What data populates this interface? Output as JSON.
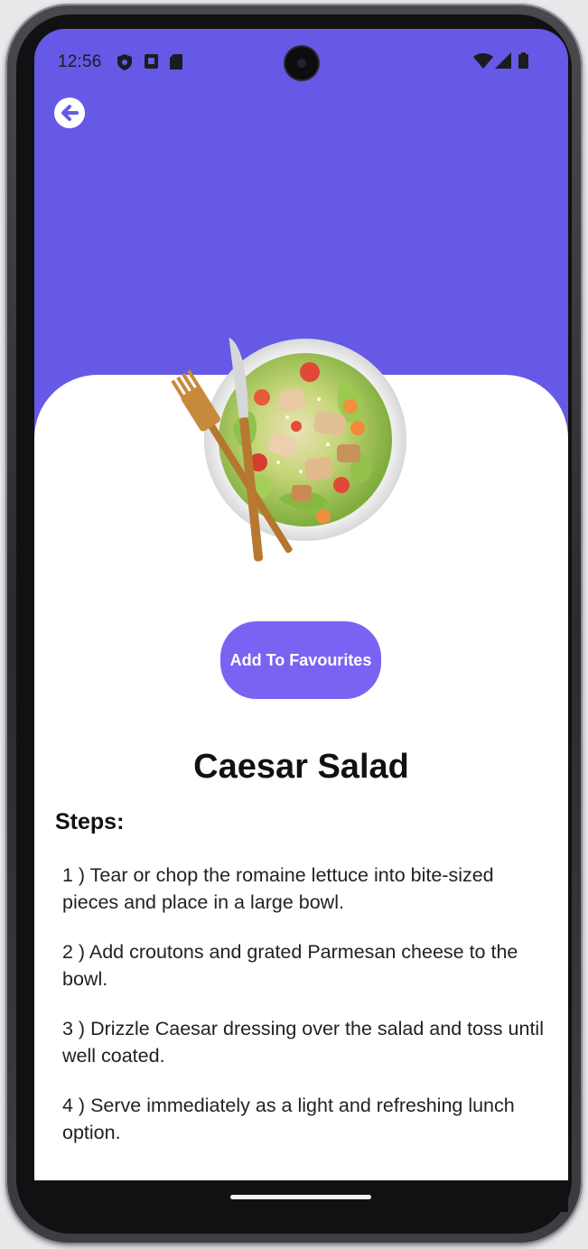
{
  "status_bar": {
    "time": "12:56",
    "left_icons": [
      "shield-icon",
      "media-icon",
      "sd-card-icon"
    ],
    "right_icons": [
      "wifi-icon",
      "signal-icon",
      "battery-icon"
    ]
  },
  "header": {
    "background_color": "#6559e6",
    "back_icon": "arrow-left-circle-icon"
  },
  "recipe": {
    "image": "caesar-salad-plate-image",
    "favourite_button_label": "Add To Favourites",
    "title": "Caesar Salad",
    "steps_heading": "Steps:",
    "steps": [
      "1 ) Tear or chop the romaine lettuce into bite-sized pieces and place in a large bowl.",
      "2 ) Add croutons and grated Parmesan cheese to the bowl.",
      "3 ) Drizzle Caesar dressing over the salad and toss until well coated.",
      "4 ) Serve immediately as a light and refreshing lunch option."
    ]
  },
  "colors": {
    "accent": "#7a63f2",
    "card": "#ffffff",
    "text": "#111111"
  }
}
